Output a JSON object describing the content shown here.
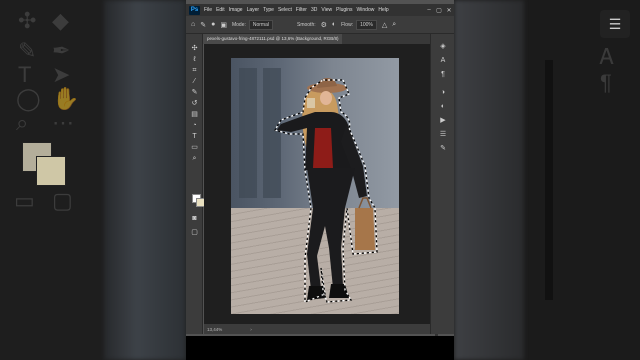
{
  "menubar": {
    "items": [
      "File",
      "Edit",
      "Image",
      "Layer",
      "Type",
      "Select",
      "Filter",
      "3D",
      "View",
      "Plugins",
      "Window",
      "Help"
    ],
    "logo": "Ps"
  },
  "options": {
    "mode_label": "Mode:",
    "mode_value": "Normal",
    "smooth_label": "Smooth:",
    "flow_label": "Flow:",
    "flow_value": "100%"
  },
  "document": {
    "tab_title": "pexels-gustavo-fring-4872111.psd @ 13,6% (Background, RGB/8)"
  },
  "status": {
    "zoom": "13,44%"
  },
  "swatches": {
    "foreground": "#ffffff",
    "background": "#e8dfbf"
  },
  "icons": {
    "toolbar": [
      "move-icon",
      "marquee-icon",
      "lasso-icon",
      "quick-select-icon",
      "crop-icon",
      "frame-icon",
      "eyedropper-icon",
      "spot-heal-icon",
      "brush-icon",
      "clone-stamp-icon",
      "history-brush-icon",
      "eraser-icon",
      "gradient-icon",
      "blur-icon",
      "dodge-icon",
      "pen-icon",
      "type-icon",
      "path-select-icon",
      "rectangle-icon",
      "hand-icon",
      "zoom-icon",
      "more-icon"
    ],
    "right_panel": [
      "layers-icon",
      "character-icon",
      "paragraph-icon",
      "styles-icon",
      "adjustments-icon",
      "play-icon",
      "properties-icon",
      "brush-settings-icon"
    ]
  }
}
